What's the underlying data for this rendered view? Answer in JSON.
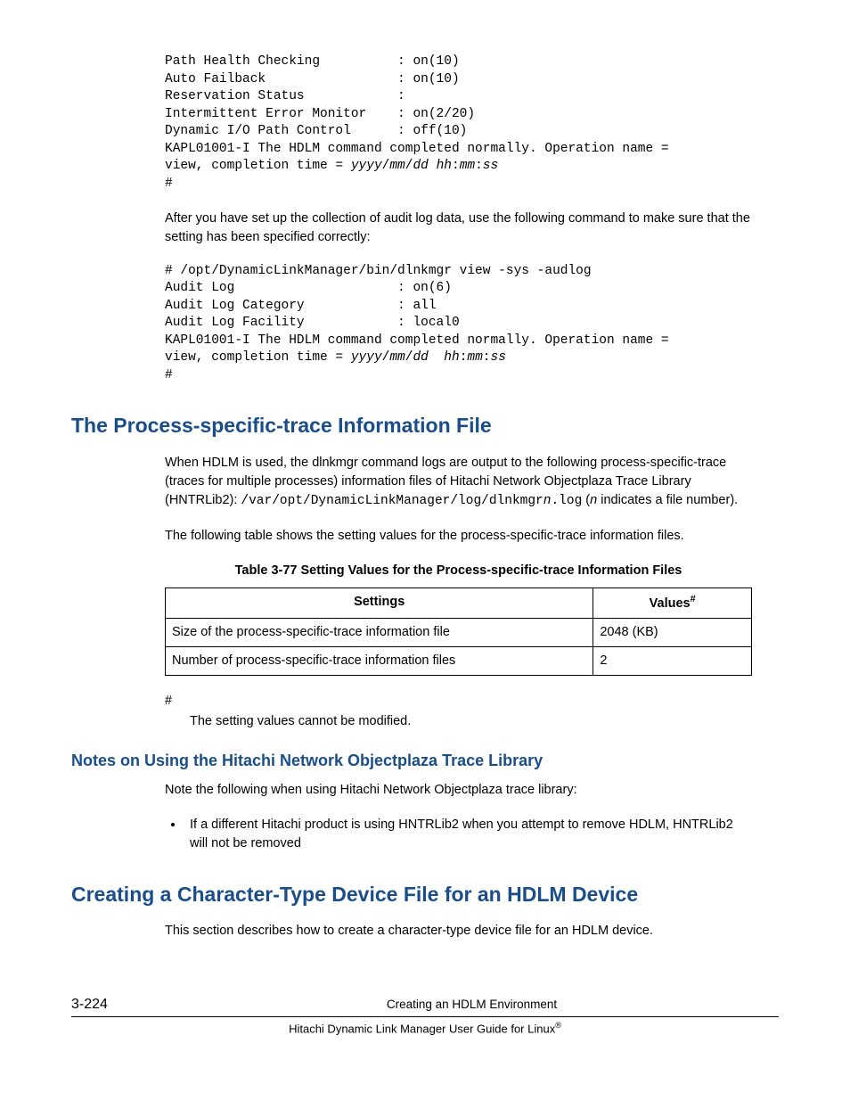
{
  "code1_l1": "Path Health Checking          : on(10)",
  "code1_l2": "Auto Failback                 : on(10)",
  "code1_l3": "Reservation Status            :",
  "code1_l4": "Intermittent Error Monitor    : on(2/20)",
  "code1_l5": "Dynamic I/O Path Control      : off(10)",
  "code1_l6": "KAPL01001-I The HDLM command completed normally. Operation name = ",
  "code1_l7a": "view, completion time = ",
  "code1_l7b": "yyyy",
  "code1_slash": "/",
  "code1_mm": "mm",
  "code1_dd": "dd",
  "code1_sp": " ",
  "code1_hh": "hh",
  "code1_colon": ":",
  "code1_ss": "ss",
  "code1_l8": "#",
  "para1": "After you have set up the collection of audit log data, use the following command to make sure that the setting has been specified correctly:",
  "code2_l1": "# /opt/DynamicLinkManager/bin/dlnkmgr view -sys -audlog",
  "code2_l2": "Audit Log                     : on(6)",
  "code2_l3": "Audit Log Category            : all",
  "code2_l4": "Audit Log Facility            : local0",
  "code2_l5": "KAPL01001-I The HDLM command completed normally. Operation name = ",
  "code2_l6a": "view, completion time = ",
  "code2_sp2": "  ",
  "code2_l7": "#",
  "h1a": "The Process-specific-trace Information File",
  "para2a": "When HDLM is used, the dlnkmgr command logs are output to the following process-specific-trace (traces for multiple processes) information files of Hitachi Network Objectplaza Trace Library (HNTRLib2): ",
  "para2_code1": "/var/opt/DynamicLinkManager/log/dlnkmgr",
  "para2_n": "n",
  "para2_code2": ".log",
  "para2b": " (",
  "para2_n2": "n",
  "para2c": " indicates a file number).",
  "para3": "The following table shows the setting values for the process-specific-trace information files.",
  "table_caption": "Table 3-77 Setting Values for the Process-specific-trace Information Files",
  "th_settings": "Settings",
  "th_values": "Values",
  "th_values_sup": "#",
  "row1_setting": "Size of the process-specific-trace information file",
  "row1_value": "2048 (KB)",
  "row2_setting": "Number of process-specific-trace information files",
  "row2_value": "2",
  "hash": "#",
  "hashnote": "The setting values cannot be modified.",
  "h2a": "Notes on Using the Hitachi Network Objectplaza Trace Library",
  "para4": "Note the following when using Hitachi Network Objectplaza trace library:",
  "bullet1": "If a different Hitachi product is using HNTRLib2 when you attempt to remove HDLM, HNTRLib2 will not be removed",
  "h1b": "Creating a Character-Type Device File for an HDLM Device",
  "para5": "This section describes how to create a character-type device file for an HDLM device.",
  "footer_page": "3-224",
  "footer_center": "Creating an HDLM Environment",
  "footer_bottom_a": "Hitachi Dynamic Link Manager User Guide for Linux",
  "footer_reg": "®"
}
